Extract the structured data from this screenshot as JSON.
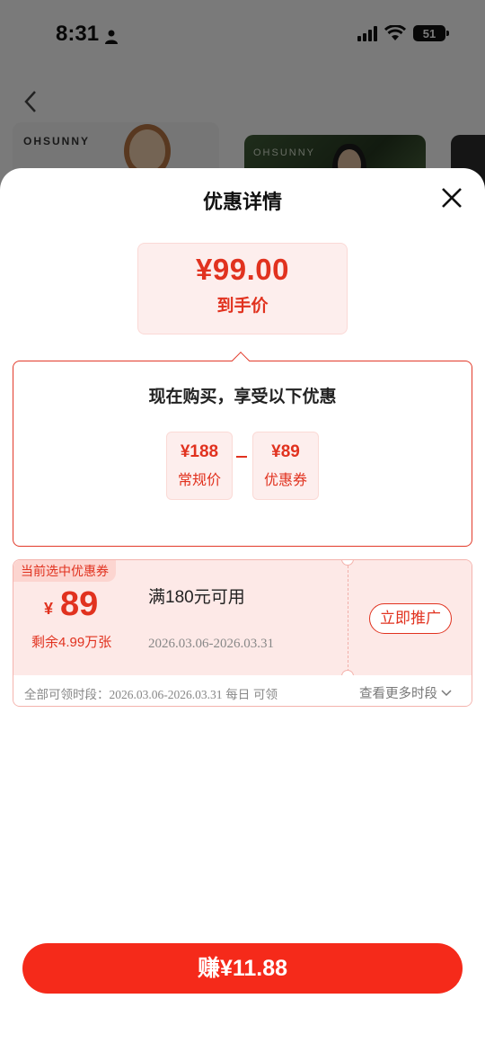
{
  "status_bar": {
    "time": "8:31",
    "battery": "51"
  },
  "background": {
    "card1_brand": "OHSUNNY",
    "card2_brand": "OHSUNNY"
  },
  "sheet": {
    "title": "优惠详情",
    "final_price": {
      "value": "¥99.00",
      "label": "到手价"
    },
    "detail": {
      "title": "现在购买，享受以下优惠",
      "regular": {
        "value": "¥188",
        "label": "常规价"
      },
      "coupon": {
        "value": "¥89",
        "label": "优惠券"
      }
    },
    "coupon_card": {
      "tag": "当前选中优惠券",
      "currency": "¥",
      "amount": "89",
      "remaining": "剩余4.99万张",
      "condition": "满180元可用",
      "date_range": "2026.03.06-2026.03.31",
      "promote_button": "立即推广",
      "period_label": "全部可领时段：",
      "period_range": "2026.03.06-2026.03.31",
      "period_suffix": " 每日 可领",
      "more_periods": "查看更多时段"
    },
    "earn_button": "赚¥11.88"
  },
  "colors": {
    "accent": "#e1321f",
    "button": "#f52a1a",
    "coupon_bg": "#fde9e7"
  }
}
